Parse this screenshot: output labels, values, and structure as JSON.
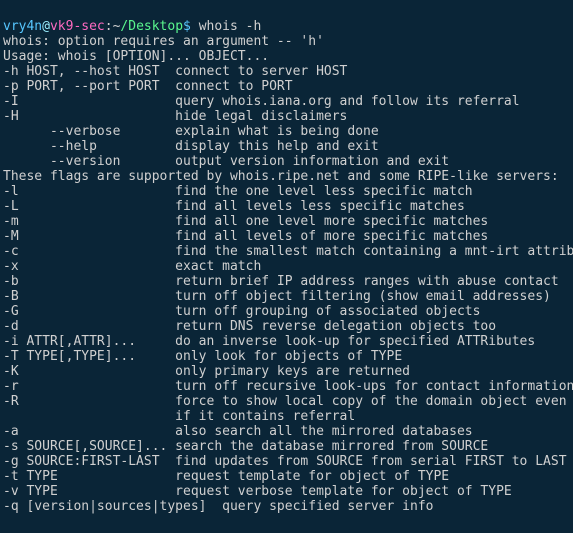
{
  "prompt": {
    "user": "vry4n",
    "at": "@",
    "host": "vk9-sec",
    "sep": ":",
    "tilde": "~",
    "path": "/Desktop",
    "dollar": "$ ",
    "command": "whois -h"
  },
  "preamble": [
    "whois: option requires an argument -- 'h'",
    "Usage: whois [OPTION]... OBJECT...",
    ""
  ],
  "opts1": [
    {
      "flag": "-h HOST, --host HOST",
      "desc": "connect to server HOST"
    },
    {
      "flag": "-p PORT, --port PORT",
      "desc": "connect to PORT"
    },
    {
      "flag": "-I",
      "desc": "query whois.iana.org and follow its referral"
    },
    {
      "flag": "-H",
      "desc": "hide legal disclaimers"
    },
    {
      "flag": "      --verbose",
      "desc": "explain what is being done"
    },
    {
      "flag": "      --help",
      "desc": "display this help and exit"
    },
    {
      "flag": "      --version",
      "desc": "output version information and exit"
    }
  ],
  "mid": [
    "",
    "These flags are supported by whois.ripe.net and some RIPE-like servers:"
  ],
  "opts2": [
    {
      "flag": "-l",
      "desc": "find the one level less specific match"
    },
    {
      "flag": "-L",
      "desc": "find all levels less specific matches"
    },
    {
      "flag": "-m",
      "desc": "find all one level more specific matches"
    },
    {
      "flag": "-M",
      "desc": "find all levels of more specific matches"
    },
    {
      "flag": "-c",
      "desc": "find the smallest match containing a mnt-irt attribute"
    },
    {
      "flag": "-x",
      "desc": "exact match"
    },
    {
      "flag": "-b",
      "desc": "return brief IP address ranges with abuse contact"
    },
    {
      "flag": "-B",
      "desc": "turn off object filtering (show email addresses)"
    },
    {
      "flag": "-G",
      "desc": "turn off grouping of associated objects"
    },
    {
      "flag": "-d",
      "desc": "return DNS reverse delegation objects too"
    },
    {
      "flag": "-i ATTR[,ATTR]...",
      "desc": "do an inverse look-up for specified ATTRibutes"
    },
    {
      "flag": "-T TYPE[,TYPE]...",
      "desc": "only look for objects of TYPE"
    },
    {
      "flag": "-K",
      "desc": "only primary keys are returned"
    },
    {
      "flag": "-r",
      "desc": "turn off recursive look-ups for contact information"
    },
    {
      "flag": "-R",
      "desc": "force to show local copy of the domain object even"
    },
    {
      "flag": "",
      "desc": "if it contains referral"
    },
    {
      "flag": "-a",
      "desc": "also search all the mirrored databases"
    },
    {
      "flag": "-s SOURCE[,SOURCE]...",
      "desc": "search the database mirrored from SOURCE"
    },
    {
      "flag": "-g SOURCE:FIRST-LAST",
      "desc": "find updates from SOURCE from serial FIRST to LAST"
    },
    {
      "flag": "-t TYPE",
      "desc": "request template for object of TYPE"
    },
    {
      "flag": "-v TYPE",
      "desc": "request verbose template for object of TYPE"
    }
  ],
  "tail": [
    "-q [version|sources|types]  query specified server info"
  ],
  "layout": {
    "col1": 22,
    "col2": 22
  }
}
